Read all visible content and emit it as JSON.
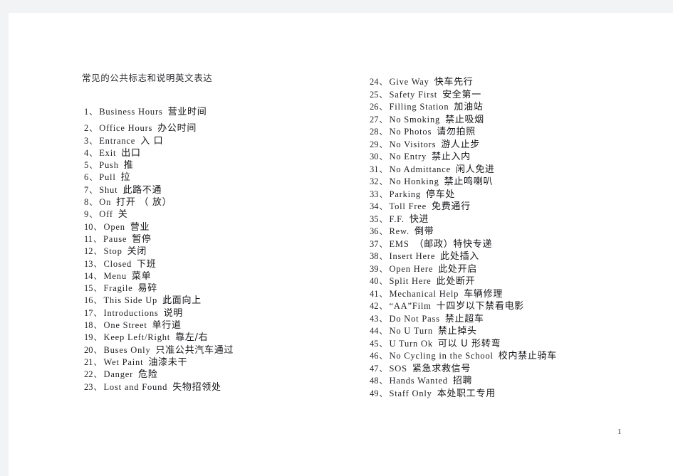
{
  "document": {
    "title": "常见的公共标志和说明英文表达",
    "page_number": "1",
    "background_color": "#f2f3f4",
    "page_color": "#ffffff",
    "text_color": "#1d1d20"
  },
  "left_column": [
    {
      "num": "1",
      "sep": "、",
      "en": "Business Hours",
      "zh": "营业时间"
    },
    {
      "num": "2",
      "sep": "、",
      "en": "Office Hours",
      "zh": "办公时间"
    },
    {
      "num": "3",
      "sep": "、",
      "en": "Entrance",
      "zh": "入 口"
    },
    {
      "num": "4",
      "sep": "、",
      "en": "Exit",
      "zh": "出口"
    },
    {
      "num": "5",
      "sep": "、",
      "en": "Push",
      "zh": "推"
    },
    {
      "num": "6",
      "sep": "、",
      "en": "Pull",
      "zh": "拉"
    },
    {
      "num": "7",
      "sep": "、",
      "en": "Shut",
      "zh": "此路不通"
    },
    {
      "num": "8",
      "sep": "、",
      "en": "On",
      "zh": "打开 （ 放）"
    },
    {
      "num": "9",
      "sep": "、",
      "en": "Off",
      "zh": "关"
    },
    {
      "num": "10",
      "sep": "、",
      "en": "Open",
      "zh": "营业"
    },
    {
      "num": "11",
      "sep": "、",
      "en": "Pause",
      "zh": "暂停"
    },
    {
      "num": "12",
      "sep": "、",
      "en": "Stop",
      "zh": "关闭"
    },
    {
      "num": "13",
      "sep": "、",
      "en": "Closed",
      "zh": "下班"
    },
    {
      "num": "14",
      "sep": "、",
      "en": "Menu",
      "zh": "菜单"
    },
    {
      "num": "15",
      "sep": "、",
      "en": "Fragile",
      "zh": "易碎"
    },
    {
      "num": "16",
      "sep": "、",
      "en": "This Side Up",
      "zh": "此面向上"
    },
    {
      "num": "17",
      "sep": "、",
      "en": "Introductions",
      "zh": "说明"
    },
    {
      "num": "18",
      "sep": "、",
      "en": "One Street",
      "zh": "单行道"
    },
    {
      "num": "19",
      "sep": "、",
      "en": "Keep Left/Right",
      "zh": "靠左/右"
    },
    {
      "num": "20",
      "sep": "、",
      "en": "Buses Only",
      "zh": "只准公共汽车通过"
    },
    {
      "num": "21",
      "sep": "、",
      "en": "Wet Paint",
      "zh": "油漆未干"
    },
    {
      "num": "22",
      "sep": "、",
      "en": "Danger",
      "zh": "危险"
    },
    {
      "num": "23",
      "sep": "、",
      "en": "Lost and Found",
      "zh": "失物招领处"
    }
  ],
  "right_column": [
    {
      "num": "24",
      "sep": "、",
      "en": "Give Way",
      "zh": "快车先行"
    },
    {
      "num": "25",
      "sep": "、",
      "en": "Safety First",
      "zh": "安全第一"
    },
    {
      "num": "26",
      "sep": "、",
      "en": "Filling Station",
      "zh": "加油站"
    },
    {
      "num": "27",
      "sep": "、",
      "en": "No Smoking",
      "zh": "禁止吸烟"
    },
    {
      "num": "28",
      "sep": "、",
      "en": "No Photos",
      "zh": "请勿拍照"
    },
    {
      "num": "29",
      "sep": "、",
      "en": "No Visitors",
      "zh": "游人止步"
    },
    {
      "num": "30",
      "sep": "、",
      "en": "No Entry",
      "zh": "禁止入内"
    },
    {
      "num": "31",
      "sep": "、",
      "en": "No Admittance",
      "zh": "闲人免进"
    },
    {
      "num": "32",
      "sep": "、",
      "en": "No Honking",
      "zh": "禁止鸣喇叭"
    },
    {
      "num": "33",
      "sep": "、",
      "en": "Parking",
      "zh": "停车处"
    },
    {
      "num": "34",
      "sep": "、",
      "en": "Toll Free",
      "zh": "免费通行"
    },
    {
      "num": "35",
      "sep": "、",
      "en": "F.F.",
      "zh": "快进"
    },
    {
      "num": "36",
      "sep": "、",
      "en": "Rew.",
      "zh": "倒带"
    },
    {
      "num": "37",
      "sep": "、",
      "en": "EMS",
      "zh": "（邮政）特快专递"
    },
    {
      "num": "38",
      "sep": "、",
      "en": "Insert Here",
      "zh": "此处插入"
    },
    {
      "num": "39",
      "sep": "、",
      "en": "Open Here",
      "zh": "此处开启"
    },
    {
      "num": "40",
      "sep": "、",
      "en": "Split Here",
      "zh": "此处断开"
    },
    {
      "num": "41",
      "sep": "、",
      "en": "Mechanical Help",
      "zh": "车辆修理"
    },
    {
      "num": "42",
      "sep": "、",
      "en": "“AA”Film",
      "zh": "十四岁以下禁看电影"
    },
    {
      "num": "43",
      "sep": "、",
      "en": "Do Not Pass",
      "zh": "禁止超车"
    },
    {
      "num": "44",
      "sep": "、",
      "en": "No U Turn",
      "zh": "禁止掉头"
    },
    {
      "num": "45",
      "sep": "、",
      "en": "U Turn Ok",
      "zh": "可以 U 形转弯"
    },
    {
      "num": "46",
      "sep": "、",
      "en": "No Cycling in the School",
      "zh": "校内禁止骑车"
    },
    {
      "num": "47",
      "sep": "、",
      "en": "SOS",
      "zh": "紧急求救信号"
    },
    {
      "num": "48",
      "sep": "、",
      "en": "Hands Wanted",
      "zh": "招聘"
    },
    {
      "num": "49",
      "sep": "、",
      "en": "Staff Only",
      "zh": "本处职工专用"
    }
  ]
}
